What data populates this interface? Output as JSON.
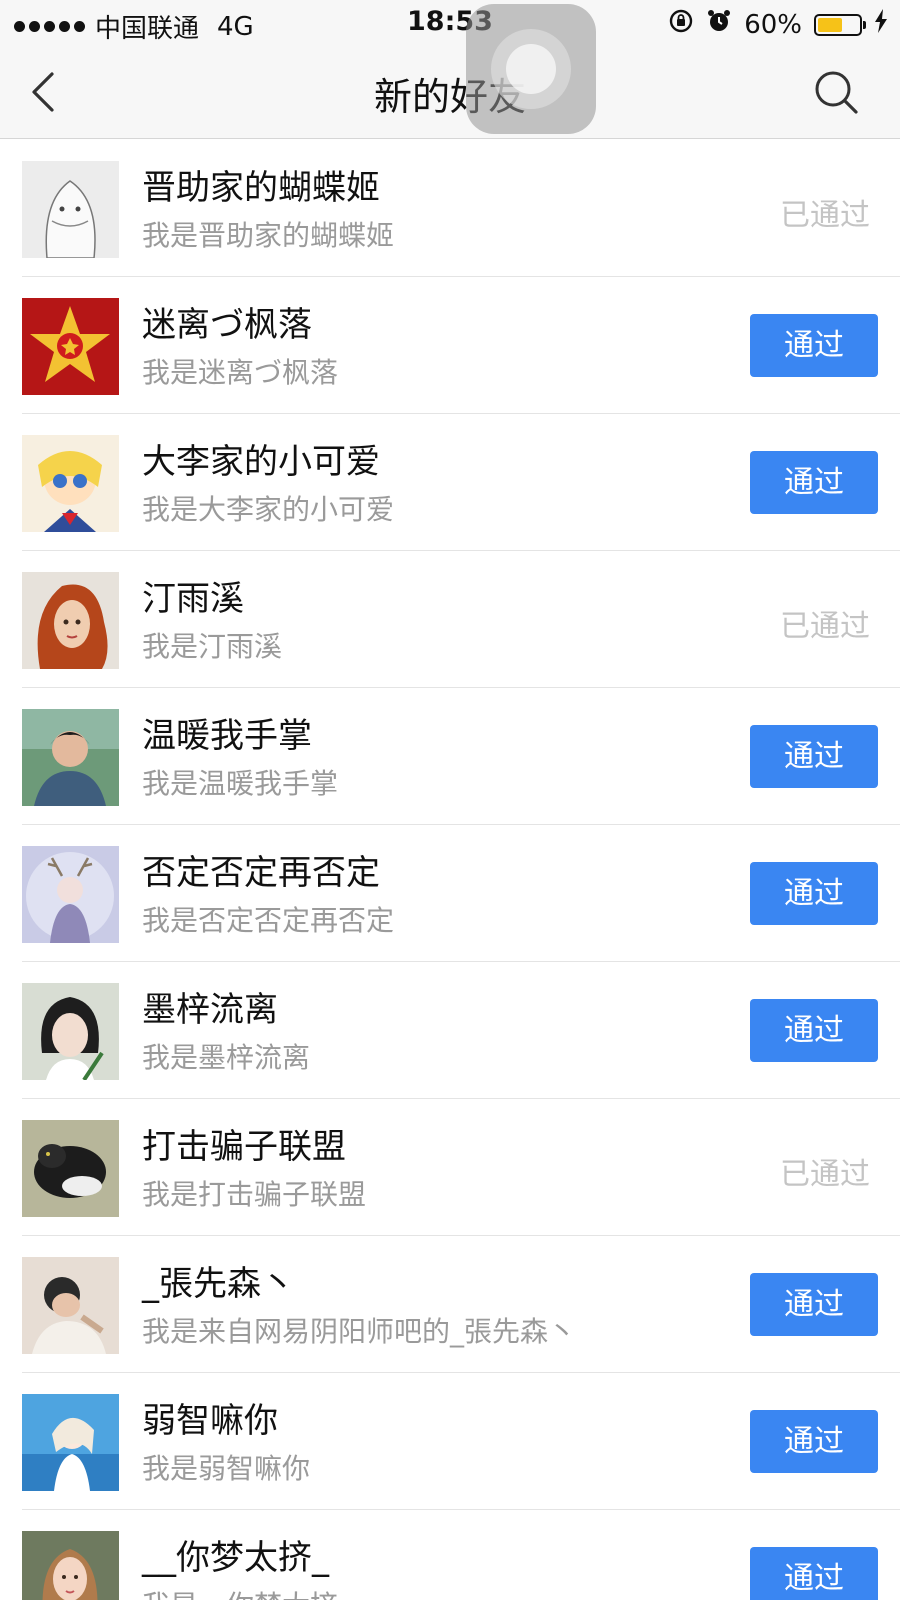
{
  "status_bar": {
    "carrier": "中国联通",
    "network": "4G",
    "time": "18:53",
    "battery_percent": "60%",
    "battery_level": 0.6,
    "battery_color": "#f6c218"
  },
  "nav": {
    "title": "新的好友",
    "back_icon": "chevron-left-icon",
    "search_icon": "search-icon"
  },
  "colors": {
    "accent": "#3a86f2",
    "accepted_text": "#c4c4c4"
  },
  "friends": [
    {
      "name": "晋助家的蝴蝶姬",
      "message": "我是晋助家的蝴蝶姬",
      "status": "已通过",
      "accepted": true
    },
    {
      "name": "迷离づ枫落",
      "message": "我是迷离づ枫落",
      "status": "通过",
      "accepted": false
    },
    {
      "name": "大李家的小可爱",
      "message": "我是大李家的小可爱",
      "status": "通过",
      "accepted": false
    },
    {
      "name": "汀雨溪",
      "message": "我是汀雨溪",
      "status": "已通过",
      "accepted": true
    },
    {
      "name": "温暖我手掌",
      "message": "我是温暖我手掌",
      "status": "通过",
      "accepted": false
    },
    {
      "name": "否定否定再否定",
      "message": "我是否定否定再否定",
      "status": "通过",
      "accepted": false
    },
    {
      "name": "墨梓流离",
      "message": "我是墨梓流离",
      "status": "通过",
      "accepted": false
    },
    {
      "name": "打击骗子联盟",
      "message": "我是打击骗子联盟",
      "status": "已通过",
      "accepted": true
    },
    {
      "name": "_張先森丶",
      "message": "我是来自网易阴阳师吧的_張先森丶",
      "status": "通过",
      "accepted": false
    },
    {
      "name": "弱智嘛你",
      "message": "我是弱智嘛你",
      "status": "通过",
      "accepted": false
    },
    {
      "name": "__你梦太挤_",
      "message": "我是__你梦太挤_",
      "status": "通过",
      "accepted": false
    }
  ]
}
